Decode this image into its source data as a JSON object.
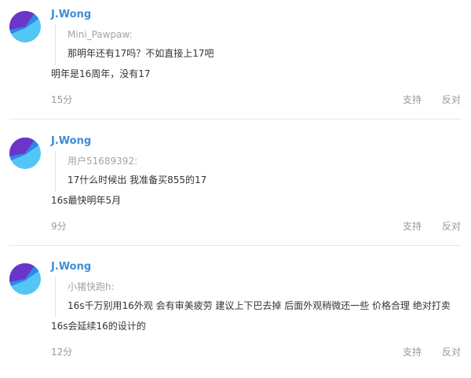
{
  "colors": {
    "username": "#3d8dd6",
    "quote_username": "#a3a3a3",
    "text": "#333333",
    "meta": "#999999",
    "avatar_dark": "#6b35c9",
    "avatar_mid": "#2f86e8",
    "avatar_light": "#54c6f5"
  },
  "icons": {
    "avatar": "avatar-icon"
  },
  "comments": [
    {
      "username": "J.Wong",
      "quote": {
        "username": "Mini_Pawpaw:",
        "text": "那明年还有17吗？不如直接上17吧"
      },
      "reply": "明年是16周年，没有17",
      "time": "15分",
      "support": "支持",
      "oppose": "反对"
    },
    {
      "username": "J.Wong",
      "quote": {
        "username": "用户51689392:",
        "text": "17什么时候出 我准备买855的17"
      },
      "reply": "16s最快明年5月",
      "time": "9分",
      "support": "支持",
      "oppose": "反对"
    },
    {
      "username": "J.Wong",
      "quote": {
        "username": "小猪快跑h:",
        "text": "16s千万别用16外观 会有审美疲劳 建议上下巴去掉 后面外观稍微还一些 价格合理 绝对打卖"
      },
      "reply": "16s会延续16的设计的",
      "time": "12分",
      "support": "支持",
      "oppose": "反对"
    }
  ]
}
